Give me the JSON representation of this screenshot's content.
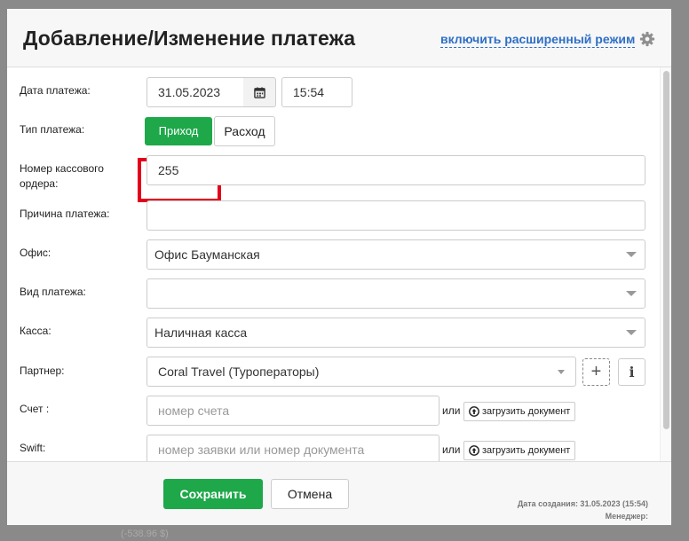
{
  "backdrop": {
    "amount": "(-538.96 $)"
  },
  "header": {
    "title": "Добавление/Изменение платежа",
    "advanced_link": "включить расширенный режим"
  },
  "form": {
    "date": {
      "label": "Дата платежа:",
      "value": "31.05.2023",
      "time": "15:54"
    },
    "type": {
      "label": "Тип платежа:",
      "income": "Приход",
      "expense": "Расход",
      "selected": "Приход"
    },
    "order_number": {
      "label": "Номер кассового ордера:",
      "value": "255"
    },
    "reason": {
      "label": "Причина платежа:",
      "value": ""
    },
    "office": {
      "label": "Офис:",
      "value": "Офис Бауманская"
    },
    "payment_kind": {
      "label": "Вид платежа:",
      "value": ""
    },
    "cashbox": {
      "label": "Касса:",
      "value": "Наличная касса"
    },
    "partner": {
      "label": "Партнер:",
      "value": "Coral Travel (Туроператоры)",
      "add_symbol": "+",
      "info_symbol": "i"
    },
    "account": {
      "label": "Счет :",
      "placeholder": "номер счета",
      "or": "или",
      "upload": "загрузить документ"
    },
    "swift": {
      "label": "Swift:",
      "placeholder": "номер заявки или номер документа",
      "or": "или",
      "upload": "загрузить документ"
    }
  },
  "footer": {
    "save": "Сохранить",
    "cancel": "Отмена",
    "created_label": "Дата создания: 31.05.2023 (15:54)",
    "manager_label": "Менеджер:"
  },
  "colors": {
    "accent_green": "#1ea84a",
    "link_blue": "#2e6fc7",
    "highlight_red": "#e3001b"
  },
  "icons": [
    "gear-icon",
    "calendar-icon",
    "plus-icon",
    "info-icon",
    "upload-icon",
    "chevron-down-icon"
  ]
}
